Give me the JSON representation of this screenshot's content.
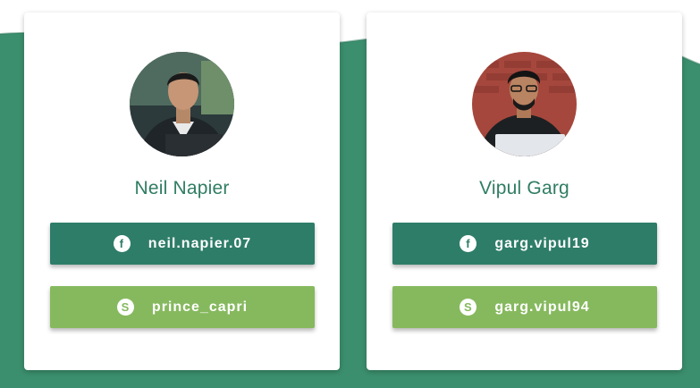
{
  "colors": {
    "background_wave": "#3b8f6e",
    "facebook_button": "#2e7d68",
    "skype_button": "#86b95e",
    "name_text": "#2f7d63",
    "card": "#ffffff"
  },
  "profiles": [
    {
      "name": "Neil Napier",
      "avatar_icon": "profile-photo",
      "facebook": {
        "icon": "facebook-icon",
        "glyph": "f",
        "handle": "neil.napier.07"
      },
      "skype": {
        "icon": "skype-icon",
        "glyph": "S",
        "handle": "prince_capri"
      }
    },
    {
      "name": "Vipul Garg",
      "avatar_icon": "profile-photo",
      "facebook": {
        "icon": "facebook-icon",
        "glyph": "f",
        "handle": "garg.vipul19"
      },
      "skype": {
        "icon": "skype-icon",
        "glyph": "S",
        "handle": "garg.vipul94"
      }
    }
  ]
}
